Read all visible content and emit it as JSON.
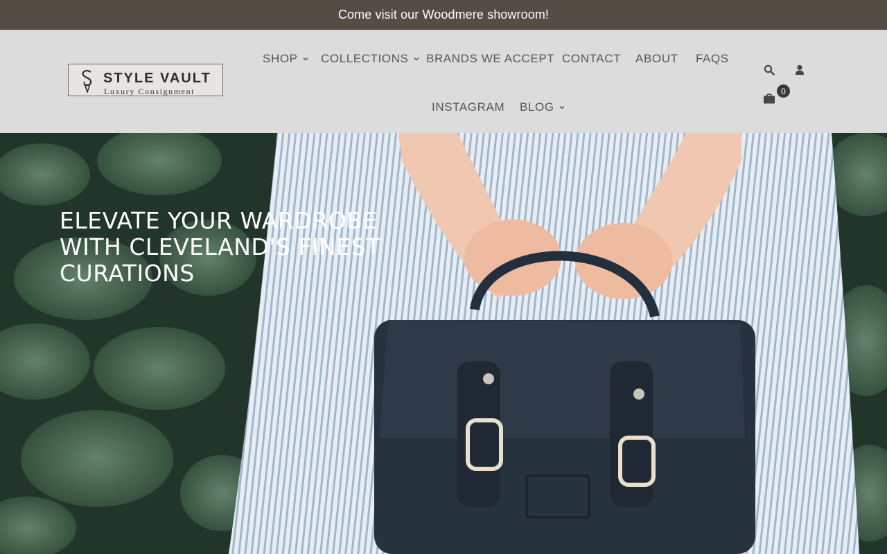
{
  "announcement": {
    "text": "Come visit our Woodmere showroom!"
  },
  "logo": {
    "title": "STYLE VAULT",
    "subtitle": "Luxury Consignment"
  },
  "nav": {
    "shop": "SHOP",
    "collections": "COLLECTIONS",
    "brands": "BRANDS WE ACCEPT",
    "contact": "CONTACT",
    "about": "ABOUT",
    "faqs": "FAQS",
    "instagram": "INSTAGRAM",
    "blog": "BLOG"
  },
  "header_icons": [
    "search-icon",
    "account-icon",
    "cart-icon"
  ],
  "cart": {
    "count": "0"
  },
  "hero": {
    "title": "ELEVATE YOUR WARDROBE WITH CLEVELAND'S FINEST CURATIONS",
    "image": "woman-holding-navy-satchel-photo"
  },
  "colors": {
    "announcement_bg": "#544d45",
    "header_bg": "#dcdcdc",
    "nav_text": "#5b5550",
    "badge_bg": "#3b3836"
  }
}
